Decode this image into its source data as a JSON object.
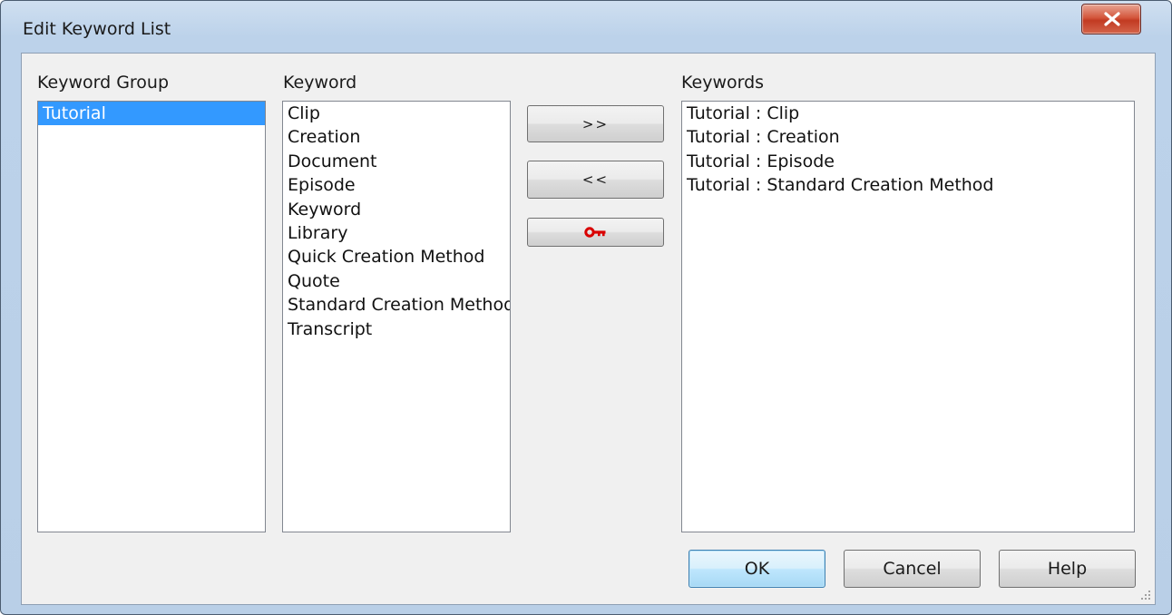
{
  "window": {
    "title": "Edit Keyword List"
  },
  "groups": {
    "label": "Keyword Group",
    "items": [
      {
        "label": "Tutorial",
        "selected": true
      }
    ]
  },
  "keywords": {
    "label": "Keyword",
    "items": [
      "Clip",
      "Creation",
      "Document",
      "Episode",
      "Keyword",
      "Library",
      "Quick Creation Method",
      "Quote",
      "Standard Creation Method",
      "Transcript"
    ]
  },
  "selected_keywords": {
    "label": "Keywords",
    "items": [
      "Tutorial : Clip",
      "Tutorial : Creation",
      "Tutorial : Episode",
      "Tutorial : Standard Creation Method"
    ]
  },
  "actions": {
    "add_label": ">>",
    "remove_label": "<<",
    "key_icon": "key-icon",
    "key_color": "#d90000"
  },
  "footer": {
    "ok": "OK",
    "cancel": "Cancel",
    "help": "Help"
  },
  "colors": {
    "selection": "#3399ff",
    "close": "#c23a22"
  }
}
